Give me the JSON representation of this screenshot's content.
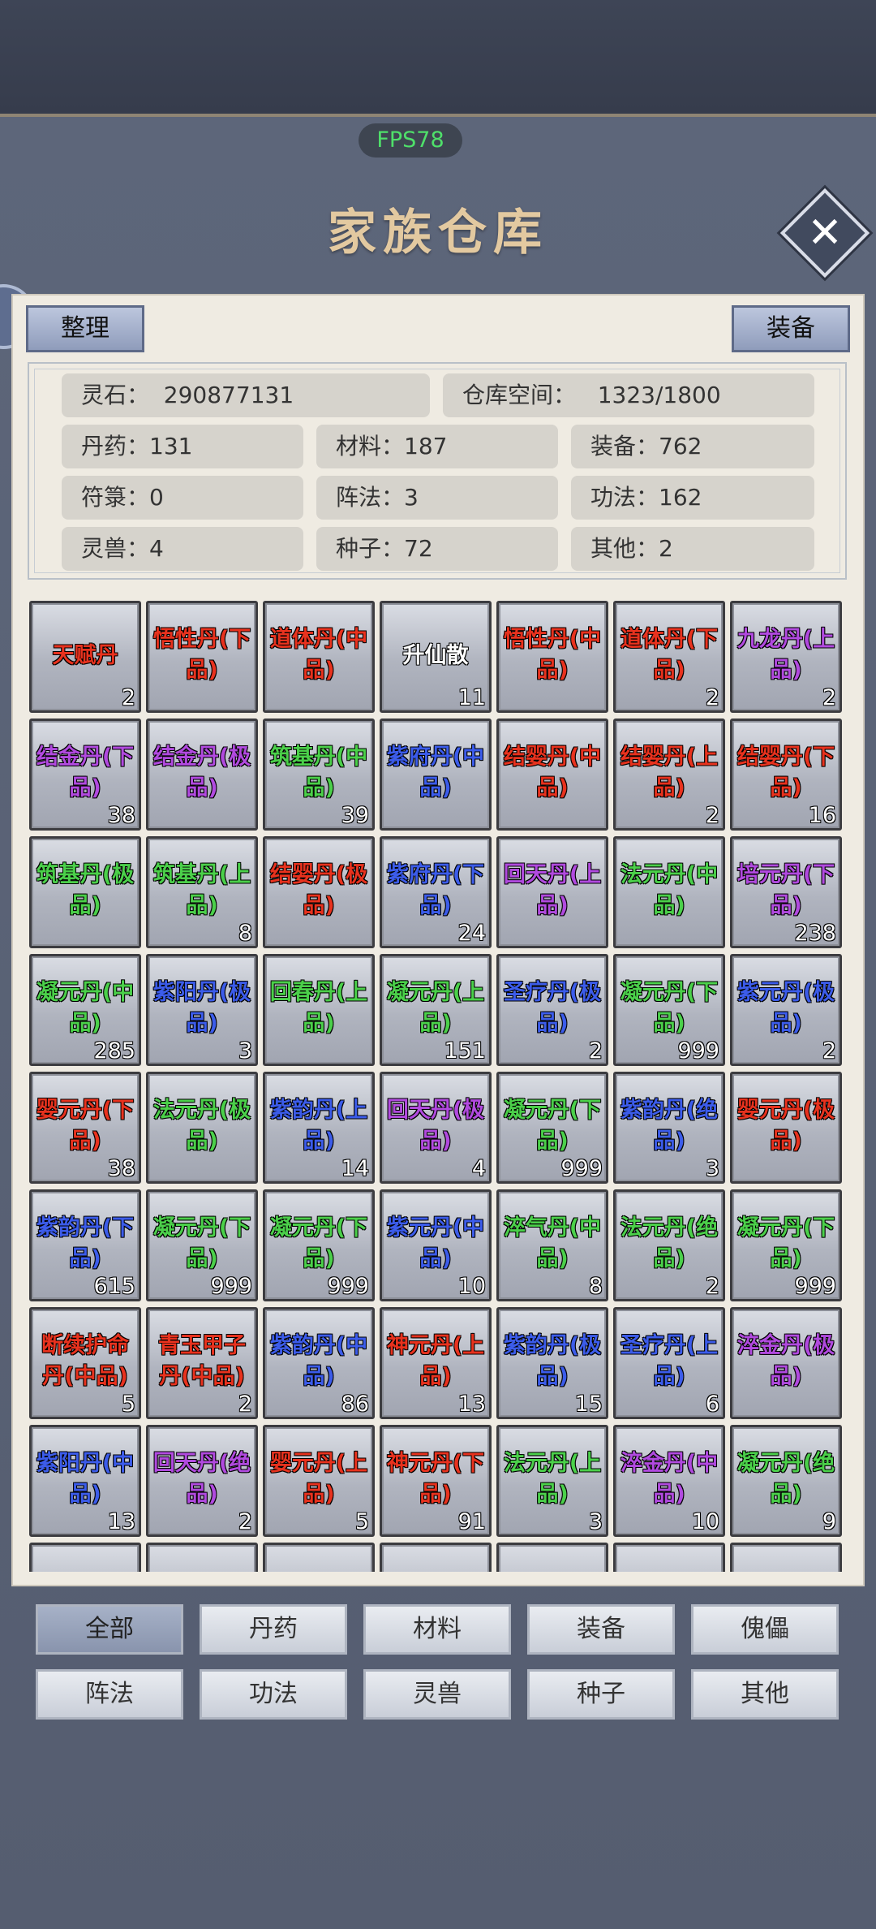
{
  "fps": "FPS78",
  "title": "家族仓库",
  "buttons": {
    "organize": "整理",
    "equip": "装备"
  },
  "info": {
    "spirit_stones": "灵石：  290877131",
    "warehouse_space": "仓库空间：   1323/1800",
    "pills": "丹药：131",
    "materials": "材料：187",
    "equipment": "装备：762",
    "talismans": "符箓：0",
    "formations": "阵法：3",
    "techniques": "功法：162",
    "beasts": "灵兽：4",
    "seeds": "种子：72",
    "others": "其他：2"
  },
  "colors": {
    "red": "#e8321e",
    "purple": "#b14adf",
    "green": "#4bd04a",
    "blue": "#3c5cea",
    "white": "#ffffff"
  },
  "items": [
    {
      "name": "天赋丹",
      "count": "2",
      "color": "red"
    },
    {
      "name": "悟性丹(下品)",
      "count": "",
      "color": "red"
    },
    {
      "name": "道体丹(中品)",
      "count": "",
      "color": "red"
    },
    {
      "name": "升仙散",
      "count": "11",
      "color": "white"
    },
    {
      "name": "悟性丹(中品)",
      "count": "",
      "color": "red"
    },
    {
      "name": "道体丹(下品)",
      "count": "2",
      "color": "red"
    },
    {
      "name": "九龙丹(上品)",
      "count": "2",
      "color": "purple"
    },
    {
      "name": "结金丹(下品)",
      "count": "38",
      "color": "purple"
    },
    {
      "name": "结金丹(极品)",
      "count": "",
      "color": "purple"
    },
    {
      "name": "筑基丹(中品)",
      "count": "39",
      "color": "green"
    },
    {
      "name": "紫府丹(中品)",
      "count": "",
      "color": "blue"
    },
    {
      "name": "结婴丹(中品)",
      "count": "",
      "color": "red"
    },
    {
      "name": "结婴丹(上品)",
      "count": "2",
      "color": "red"
    },
    {
      "name": "结婴丹(下品)",
      "count": "16",
      "color": "red"
    },
    {
      "name": "筑基丹(极品)",
      "count": "",
      "color": "green"
    },
    {
      "name": "筑基丹(上品)",
      "count": "8",
      "color": "green"
    },
    {
      "name": "结婴丹(极品)",
      "count": "",
      "color": "red"
    },
    {
      "name": "紫府丹(下品)",
      "count": "24",
      "color": "blue"
    },
    {
      "name": "回天丹(上品)",
      "count": "",
      "color": "purple"
    },
    {
      "name": "法元丹(中品)",
      "count": "",
      "color": "green"
    },
    {
      "name": "培元丹(下品)",
      "count": "238",
      "color": "purple"
    },
    {
      "name": "凝元丹(中品)",
      "count": "285",
      "color": "green"
    },
    {
      "name": "紫阳丹(极品)",
      "count": "3",
      "color": "blue"
    },
    {
      "name": "回春丹(上品)",
      "count": "",
      "color": "green"
    },
    {
      "name": "凝元丹(上品)",
      "count": "151",
      "color": "green"
    },
    {
      "name": "圣疗丹(极品)",
      "count": "2",
      "color": "blue"
    },
    {
      "name": "凝元丹(下品)",
      "count": "999",
      "color": "green"
    },
    {
      "name": "紫元丹(极品)",
      "count": "2",
      "color": "blue"
    },
    {
      "name": "婴元丹(下品)",
      "count": "38",
      "color": "red"
    },
    {
      "name": "法元丹(极品)",
      "count": "",
      "color": "green"
    },
    {
      "name": "紫韵丹(上品)",
      "count": "14",
      "color": "blue"
    },
    {
      "name": "回天丹(极品)",
      "count": "4",
      "color": "purple"
    },
    {
      "name": "凝元丹(下品)",
      "count": "999",
      "color": "green"
    },
    {
      "name": "紫韵丹(绝品)",
      "count": "3",
      "color": "blue"
    },
    {
      "name": "婴元丹(极品)",
      "count": "",
      "color": "red"
    },
    {
      "name": "紫韵丹(下品)",
      "count": "615",
      "color": "blue"
    },
    {
      "name": "凝元丹(下品)",
      "count": "999",
      "color": "green"
    },
    {
      "name": "凝元丹(下品)",
      "count": "999",
      "color": "green"
    },
    {
      "name": "紫元丹(中品)",
      "count": "10",
      "color": "blue"
    },
    {
      "name": "淬气丹(中品)",
      "count": "8",
      "color": "green"
    },
    {
      "name": "法元丹(绝品)",
      "count": "2",
      "color": "green"
    },
    {
      "name": "凝元丹(下品)",
      "count": "999",
      "color": "green"
    },
    {
      "name": "断续护命丹(中品)",
      "count": "5",
      "color": "red"
    },
    {
      "name": "青玉甲子丹(中品)",
      "count": "2",
      "color": "red"
    },
    {
      "name": "紫韵丹(中品)",
      "count": "86",
      "color": "blue"
    },
    {
      "name": "神元丹(上品)",
      "count": "13",
      "color": "red"
    },
    {
      "name": "紫韵丹(极品)",
      "count": "15",
      "color": "blue"
    },
    {
      "name": "圣疗丹(上品)",
      "count": "6",
      "color": "blue"
    },
    {
      "name": "淬金丹(极品)",
      "count": "",
      "color": "purple"
    },
    {
      "name": "紫阳丹(中品)",
      "count": "13",
      "color": "blue"
    },
    {
      "name": "回天丹(绝品)",
      "count": "2",
      "color": "purple"
    },
    {
      "name": "婴元丹(上品)",
      "count": "5",
      "color": "red"
    },
    {
      "name": "神元丹(下品)",
      "count": "91",
      "color": "red"
    },
    {
      "name": "法元丹(上品)",
      "count": "3",
      "color": "green"
    },
    {
      "name": "淬金丹(中品)",
      "count": "10",
      "color": "purple"
    },
    {
      "name": "凝元丹(绝品)",
      "count": "9",
      "color": "green"
    }
  ],
  "tabs": [
    {
      "label": "全部",
      "active": true
    },
    {
      "label": "丹药",
      "active": false
    },
    {
      "label": "材料",
      "active": false
    },
    {
      "label": "装备",
      "active": false
    },
    {
      "label": "傀儡",
      "active": false
    },
    {
      "label": "阵法",
      "active": false
    },
    {
      "label": "功法",
      "active": false
    },
    {
      "label": "灵兽",
      "active": false
    },
    {
      "label": "种子",
      "active": false
    },
    {
      "label": "其他",
      "active": false
    }
  ]
}
